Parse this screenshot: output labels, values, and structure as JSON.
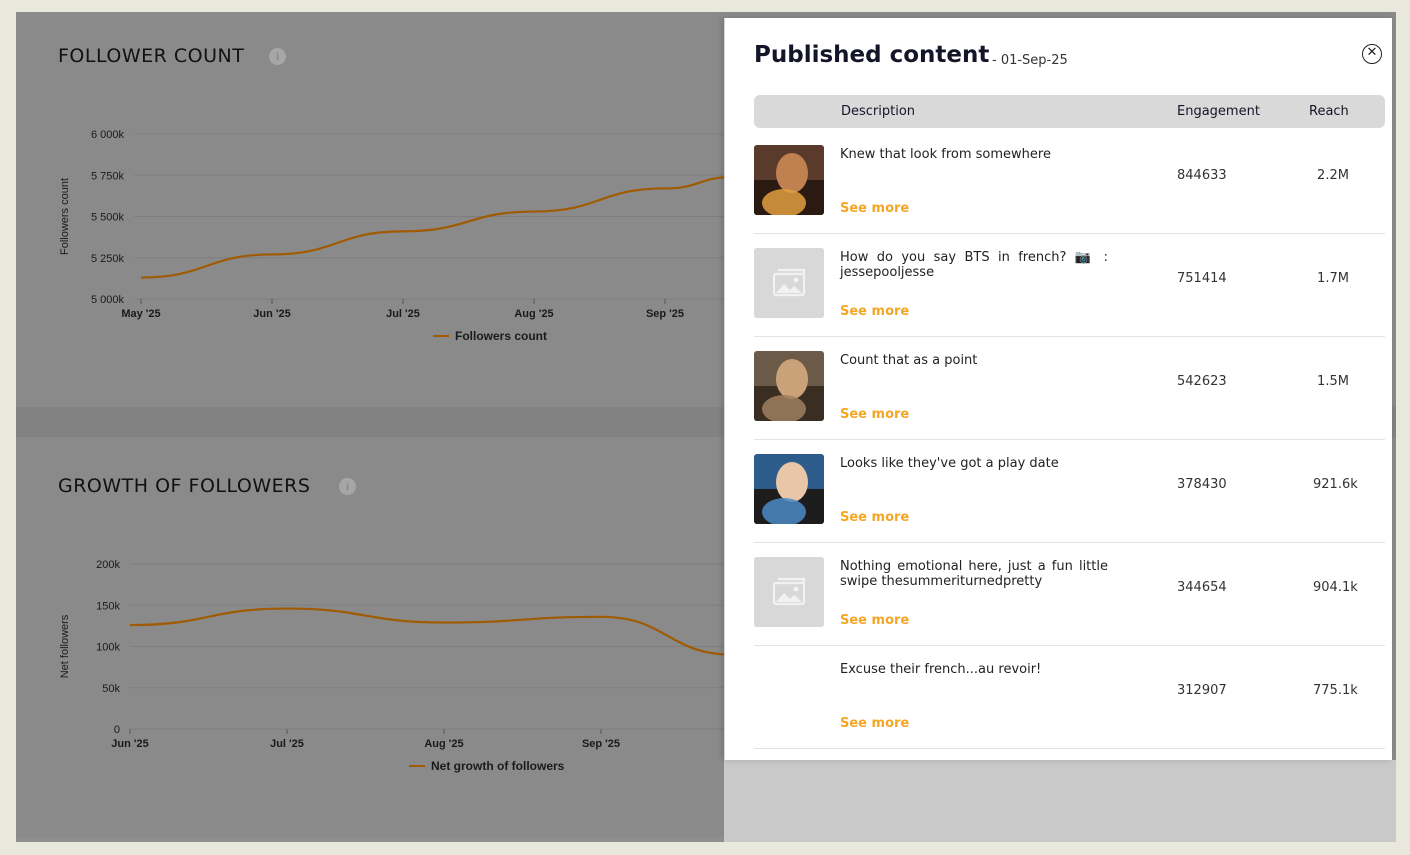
{
  "follower_card": {
    "title": "FOLLOWER COUNT",
    "legend": "Followers count",
    "ylabel": "Followers count",
    "y_ticks": [
      "6 000k",
      "5 750k",
      "5 500k",
      "5 250k",
      "5 000k"
    ],
    "x_ticks": [
      "May '25",
      "Jun '25",
      "Jul '25",
      "Aug '25",
      "Sep '25"
    ]
  },
  "growth_card": {
    "title": "GROWTH OF FOLLOWERS",
    "legend": "Net growth of followers",
    "ylabel": "Net followers",
    "y_ticks": [
      "200k",
      "150k",
      "100k",
      "50k",
      "0"
    ],
    "x_ticks": [
      "Jun '25",
      "Jul '25",
      "Aug '25",
      "Sep '25"
    ]
  },
  "chart_data": [
    {
      "type": "line",
      "title": "FOLLOWER COUNT",
      "ylabel": "Followers count",
      "xlabel": "",
      "ylim": [
        5000000,
        6000000
      ],
      "x": [
        "May '25",
        "Jun '25",
        "Jul '25",
        "Aug '25",
        "Sep '25"
      ],
      "series": [
        {
          "name": "Followers count",
          "values": [
            5130000,
            5270000,
            5410000,
            5530000,
            5670000
          ]
        }
      ]
    },
    {
      "type": "line",
      "title": "GROWTH OF FOLLOWERS",
      "ylabel": "Net followers",
      "xlabel": "",
      "ylim": [
        0,
        200000
      ],
      "x": [
        "Jun '25",
        "Jul '25",
        "Aug '25",
        "Sep '25"
      ],
      "series": [
        {
          "name": "Net growth of followers",
          "values": [
            126000,
            146000,
            129000,
            136000
          ]
        }
      ]
    }
  ],
  "drawer": {
    "title": "Published content",
    "date": "- 01-Sep-25",
    "close_icon": "close-circle-icon",
    "columns": {
      "description": "Description",
      "engagement": "Engagement",
      "reach": "Reach"
    },
    "see_more_label": "See more",
    "accent_color": "#f5a623",
    "rows": [
      {
        "thumb": "photo",
        "description": "Knew that look from somewhere",
        "engagement": "844633",
        "reach": "2.2M"
      },
      {
        "thumb": "placeholder",
        "description": "How do you say BTS in french? 📷 : jessepooljesse",
        "engagement": "751414",
        "reach": "1.7M"
      },
      {
        "thumb": "photo",
        "description": "Count that as a point",
        "engagement": "542623",
        "reach": "1.5M"
      },
      {
        "thumb": "photo",
        "description": "Looks like they've got a play date",
        "engagement": "378430",
        "reach": "921.6k"
      },
      {
        "thumb": "placeholder",
        "description": "Nothing emotional here, just a fun little swipe thesummeriturnedpretty",
        "engagement": "344654",
        "reach": "904.1k"
      },
      {
        "thumb": "none",
        "description": "Excuse their french...au revoir!",
        "engagement": "312907",
        "reach": "775.1k"
      }
    ]
  }
}
